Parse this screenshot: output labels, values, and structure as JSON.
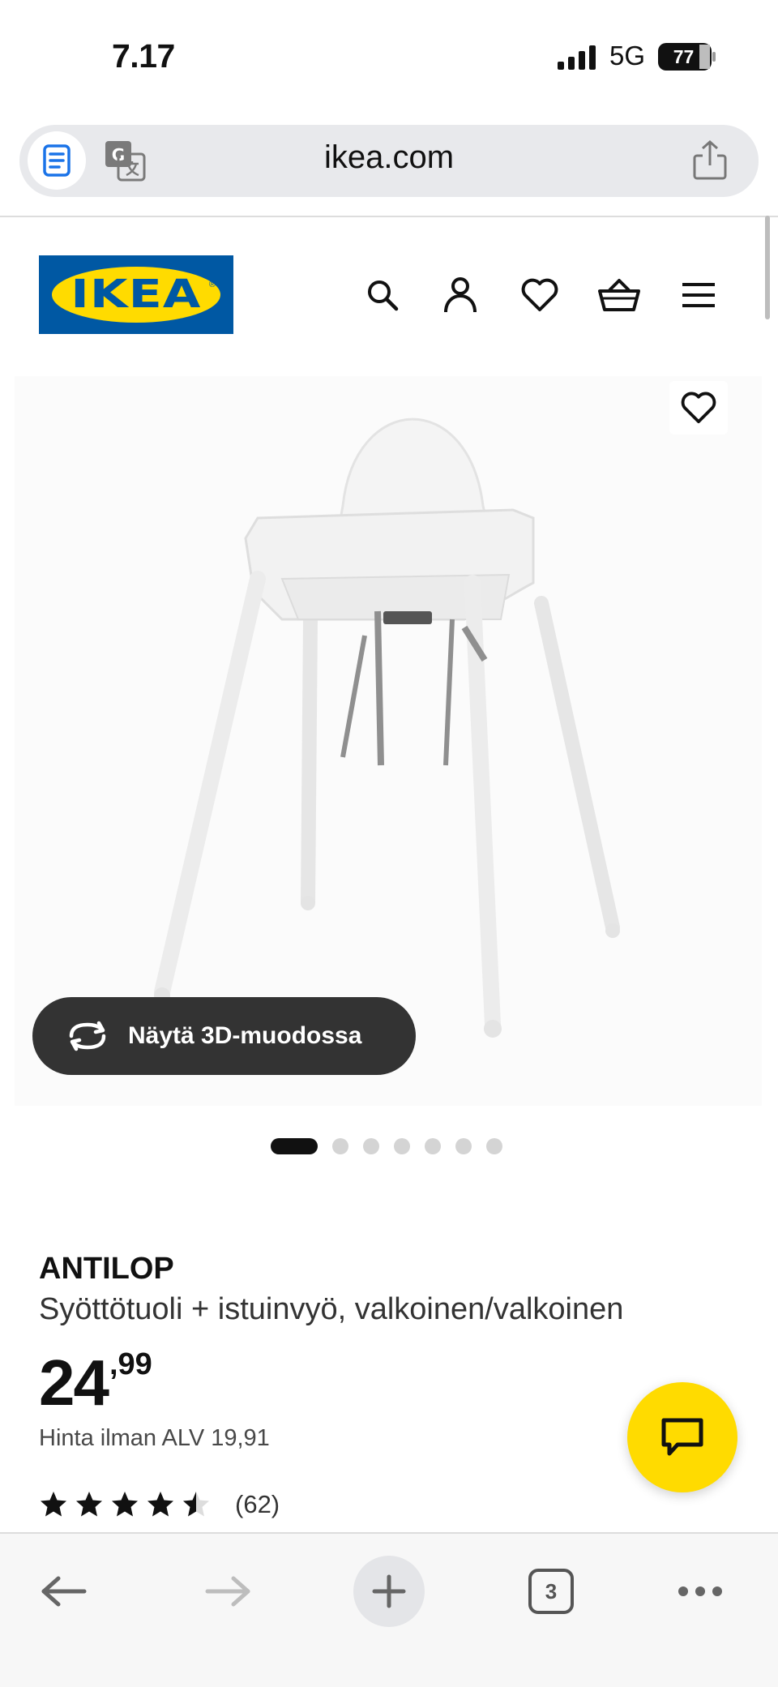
{
  "status_bar": {
    "time": "7.17",
    "network": "5G",
    "battery": "77"
  },
  "browser": {
    "url": "ikea.com",
    "icons": {
      "reader": "reader-icon",
      "translate": "translate-icon",
      "share": "share-icon"
    }
  },
  "header": {
    "logo_text": "IKEA",
    "icons": [
      "search-icon",
      "account-icon",
      "heart-icon",
      "basket-icon",
      "menu-icon"
    ]
  },
  "gallery": {
    "view_3d_label": "Näytä 3D-muodossa",
    "dot_count": 7,
    "active_dot": 0
  },
  "product": {
    "brand": "ANTILOP",
    "description": "Syöttötuoli + istuinvyö, valkoinen/valkoinen",
    "price_integer": "24",
    "price_decimal": ",99",
    "price_excl_vat": "Hinta ilman ALV 19,91",
    "rating": 4.5,
    "rating_max": 5,
    "review_count": "(62)"
  },
  "toolbar": {
    "tab_count": "3"
  },
  "colors": {
    "ikea_blue": "#0058a3",
    "ikea_yellow": "#ffdb00",
    "dark_button": "#333333"
  }
}
